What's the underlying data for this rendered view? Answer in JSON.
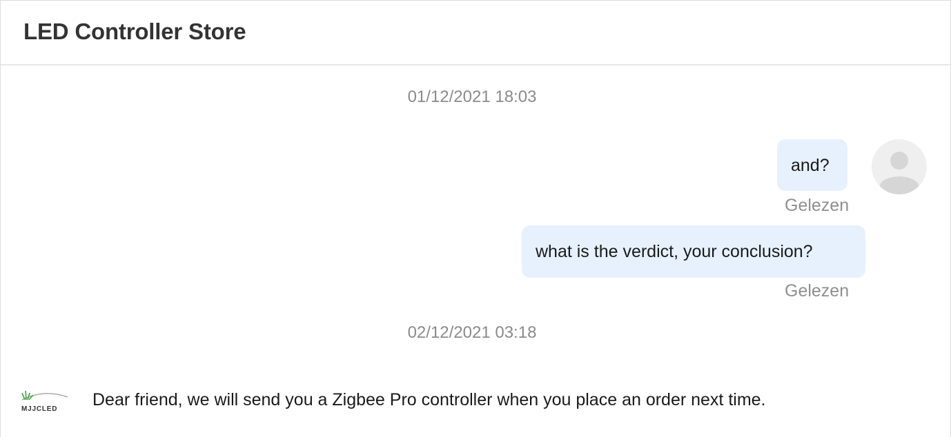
{
  "header": {
    "title": "LED Controller Store"
  },
  "conversation": {
    "timestamps": [
      "01/12/2021 18:03",
      "02/12/2021 03:18"
    ],
    "outgoing": [
      {
        "text": "and?",
        "status": "Gelezen"
      },
      {
        "text": "what is the verdict, your conclusion?",
        "status": "Gelezen"
      }
    ],
    "incoming": [
      {
        "sender_logo": "MJJCLED",
        "text": "Dear friend, we will send you a Zigbee Pro controller when you place an order next time."
      }
    ]
  },
  "icons": {
    "user_avatar": "user-avatar-icon",
    "store_logo": "store-logo-icon"
  },
  "colors": {
    "outgoing_bubble": "#e6f1fd",
    "timestamp_text": "#8a8a8a",
    "status_text": "#8f8f8f",
    "logo_leaf": "#3aa13a"
  }
}
